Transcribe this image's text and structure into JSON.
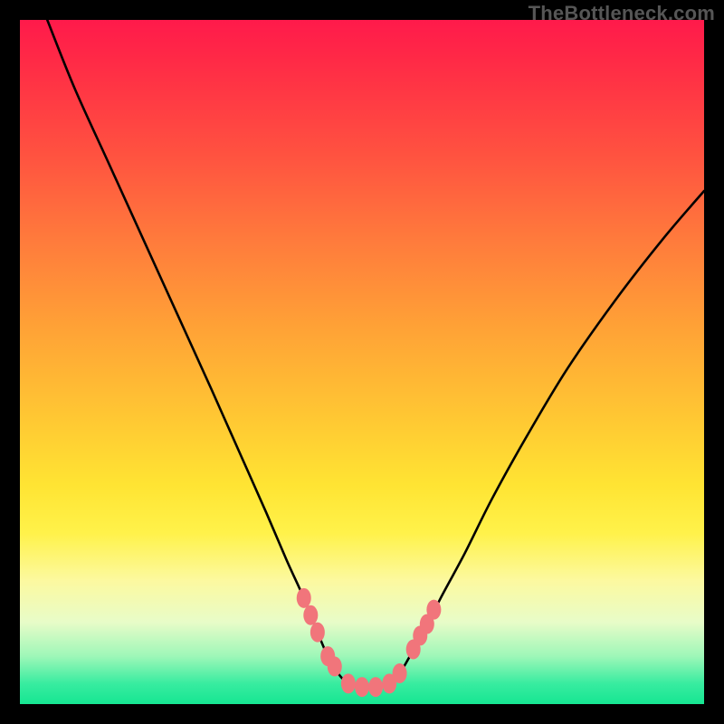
{
  "watermark": "TheBottleneck.com",
  "chart_data": {
    "type": "line",
    "title": "",
    "xlabel": "",
    "ylabel": "",
    "xlim": [
      0,
      100
    ],
    "ylim": [
      0,
      100
    ],
    "series": [
      {
        "name": "curve",
        "x": [
          4,
          8,
          13,
          18,
          23,
          28,
          32,
          36,
          39,
          41.5,
          43.5,
          45,
          46.5,
          48,
          50,
          52,
          54,
          55.5,
          57,
          59,
          61.5,
          65,
          69,
          74,
          80,
          87,
          94,
          100
        ],
        "y": [
          100,
          90,
          79,
          68,
          57,
          46,
          37,
          28,
          21,
          15.5,
          10.5,
          7,
          4.5,
          3,
          2.5,
          2.5,
          3,
          4.5,
          7,
          10.5,
          15.5,
          22,
          30,
          39,
          49,
          59,
          68,
          75
        ]
      }
    ],
    "markers": [
      {
        "x": 41.5,
        "y": 15.5
      },
      {
        "x": 42.5,
        "y": 13.0
      },
      {
        "x": 43.5,
        "y": 10.5
      },
      {
        "x": 45.0,
        "y": 7.0
      },
      {
        "x": 46.0,
        "y": 5.5
      },
      {
        "x": 48.0,
        "y": 3.0
      },
      {
        "x": 50.0,
        "y": 2.5
      },
      {
        "x": 52.0,
        "y": 2.5
      },
      {
        "x": 54.0,
        "y": 3.0
      },
      {
        "x": 55.5,
        "y": 4.5
      },
      {
        "x": 57.5,
        "y": 8.0
      },
      {
        "x": 58.5,
        "y": 10.0
      },
      {
        "x": 59.5,
        "y": 11.7
      },
      {
        "x": 60.5,
        "y": 13.8
      }
    ],
    "marker_color": "#f1757b"
  }
}
